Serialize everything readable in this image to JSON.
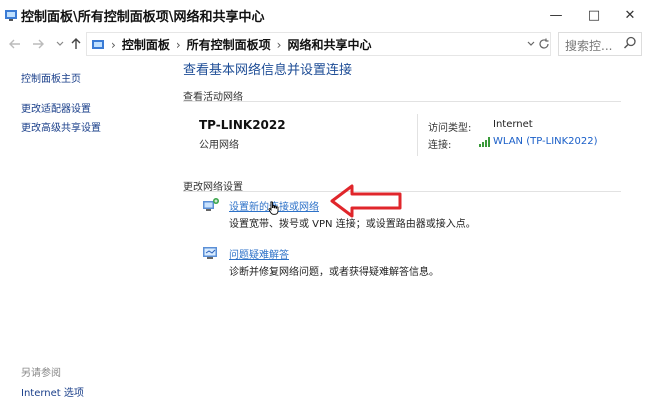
{
  "window": {
    "title": "控制面板\\所有控制面板项\\网络和共享中心",
    "minimize": "—",
    "maximize": "□",
    "close": "✕"
  },
  "address": {
    "crumbs": [
      "控制面板",
      "所有控制面板项",
      "网络和共享中心"
    ],
    "search_placeholder": "搜索控..."
  },
  "sidebar": {
    "links": [
      "控制面板主页",
      "更改适配器设置",
      "更改高级共享设置"
    ],
    "see_also": "另请参阅",
    "bottom_link": "Internet 选项"
  },
  "main": {
    "heading": "查看基本网络信息并设置连接",
    "active_label": "查看活动网络",
    "network_name": "TP-LINK2022",
    "network_type": "公用网络",
    "access_label": "访问类型:",
    "access_value": "Internet",
    "connection_label": "连接:",
    "connection_value": "WLAN (TP-LINK2022)",
    "change_label": "更改网络设置",
    "tasks": [
      {
        "title": "设置新的连接或网络",
        "desc": "设置宽带、拨号或 VPN 连接；或设置路由器或接入点。"
      },
      {
        "title": "问题疑难解答",
        "desc": "诊断并修复网络问题，或者获得疑难解答信息。"
      }
    ]
  },
  "colors": {
    "link": "#1a3f8a",
    "heading": "#1e4d96",
    "annotation_arrow": "#e0262b"
  },
  "icons": [
    "control-panel-icon",
    "back-arrow-icon",
    "forward-arrow-icon",
    "up-arrow-icon",
    "search-icon",
    "wifi-signal-icon",
    "new-connection-icon",
    "troubleshoot-icon",
    "red-arrow-annotation",
    "hand-cursor"
  ]
}
